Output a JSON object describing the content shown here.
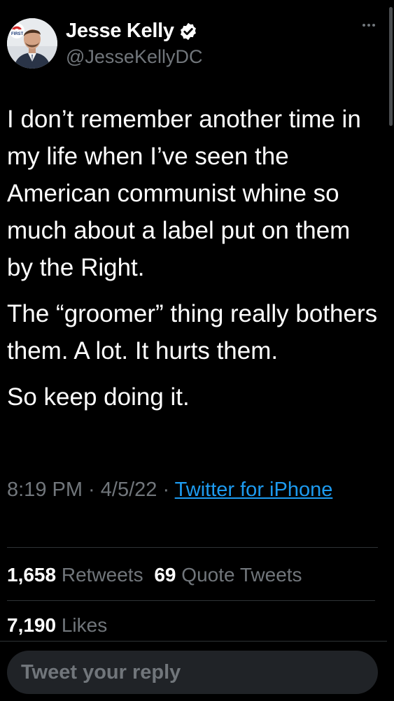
{
  "author": {
    "name": "Jesse Kelly",
    "handle": "@JesseKellyDC",
    "avatar_badge": "FIRST",
    "verified": true
  },
  "tweet": {
    "paragraphs": [
      "I don’t remember another time in my life when I’ve seen the American communist whine so much about a label put on them by the Right.",
      "The “groomer” thing really bothers them. A lot. It hurts them.",
      "So keep doing it."
    ]
  },
  "meta": {
    "time": "8:19 PM",
    "separator": " · ",
    "date": "4/5/22",
    "source": "Twitter for iPhone"
  },
  "stats": {
    "retweets_count": "1,658",
    "retweets_label": "Retweets",
    "quotes_count": "69",
    "quotes_label": "Quote Tweets",
    "likes_count": "7,190",
    "likes_label": "Likes"
  },
  "reply": {
    "placeholder": "Tweet your reply"
  },
  "icons": {
    "more": "more-horizontal-icon",
    "verified": "verified-badge-icon"
  },
  "colors": {
    "background": "#000000",
    "text": "#ffffff",
    "secondary": "#71767b",
    "link": "#1d9bf0",
    "divider": "#2f3336"
  }
}
